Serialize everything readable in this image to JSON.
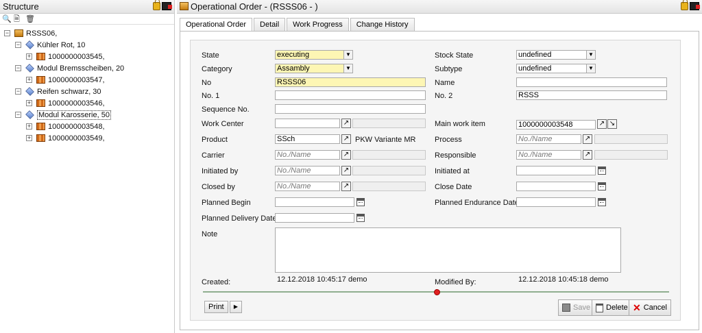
{
  "structure": {
    "title": "Structure",
    "tree": [
      {
        "label": "RSSS06,",
        "level": 0,
        "type": "box",
        "expander": "−"
      },
      {
        "label": "Kühler Rot, 10",
        "level": 1,
        "type": "cube",
        "expander": "−"
      },
      {
        "label": "1000000003545,",
        "level": 2,
        "type": "item",
        "expander": "+"
      },
      {
        "label": "Modul Bremsscheiben, 20",
        "level": 1,
        "type": "cube",
        "expander": "−"
      },
      {
        "label": "1000000003547,",
        "level": 2,
        "type": "item",
        "expander": "+"
      },
      {
        "label": "Reifen schwarz, 30",
        "level": 1,
        "type": "cube",
        "expander": "−"
      },
      {
        "label": "1000000003546,",
        "level": 2,
        "type": "item",
        "expander": "+"
      },
      {
        "label": "Modul Karosserie, 50",
        "level": 1,
        "type": "cube",
        "expander": "−"
      },
      {
        "label": "1000000003548,",
        "level": 2,
        "type": "item",
        "expander": "+"
      },
      {
        "label": "1000000003549,",
        "level": 2,
        "type": "item",
        "expander": "+"
      }
    ]
  },
  "order": {
    "title": "Operational Order - (RSSS06 - )",
    "tabs": [
      "Operational Order",
      "Detail",
      "Work Progress",
      "Change History"
    ],
    "labels": {
      "state": "State",
      "category": "Category",
      "no": "No",
      "no1": "No. 1",
      "sequence": "Sequence No.",
      "work_center": "Work Center",
      "product": "Product",
      "carrier": "Carrier",
      "initiated_by": "Initiated by",
      "closed_by": "Closed by",
      "planned_begin": "Planned Begin",
      "planned_delivery": "Planned Delivery Date",
      "note": "Note",
      "created": "Created:",
      "stock_state": "Stock State",
      "subtype": "Subtype",
      "name": "Name",
      "no2": "No. 2",
      "main_work_item": "Main work item",
      "process": "Process",
      "responsible": "Responsible",
      "initiated_at": "Initiated at",
      "close_date": "Close Date",
      "planned_endurance": "Planned Endurance Date",
      "modified_by": "Modified By:"
    },
    "values": {
      "state": "executing",
      "category": "Assambly",
      "no": "RSSS06",
      "no1": "",
      "sequence": "",
      "work_center": "",
      "product": "SSch",
      "product_name": "PKW Variante MR",
      "stock_state": "undefined",
      "subtype": "undefined",
      "name": "",
      "no2": "RSSS",
      "main_work_item": "1000000003548",
      "created": "12.12.2018 10:45:17 demo",
      "modified": "12.12.2018 10:45:18 demo"
    },
    "placeholder": "No./Name",
    "buttons": {
      "print": "Print",
      "save": "Save",
      "delete": "Delete",
      "cancel": "Cancel"
    }
  }
}
